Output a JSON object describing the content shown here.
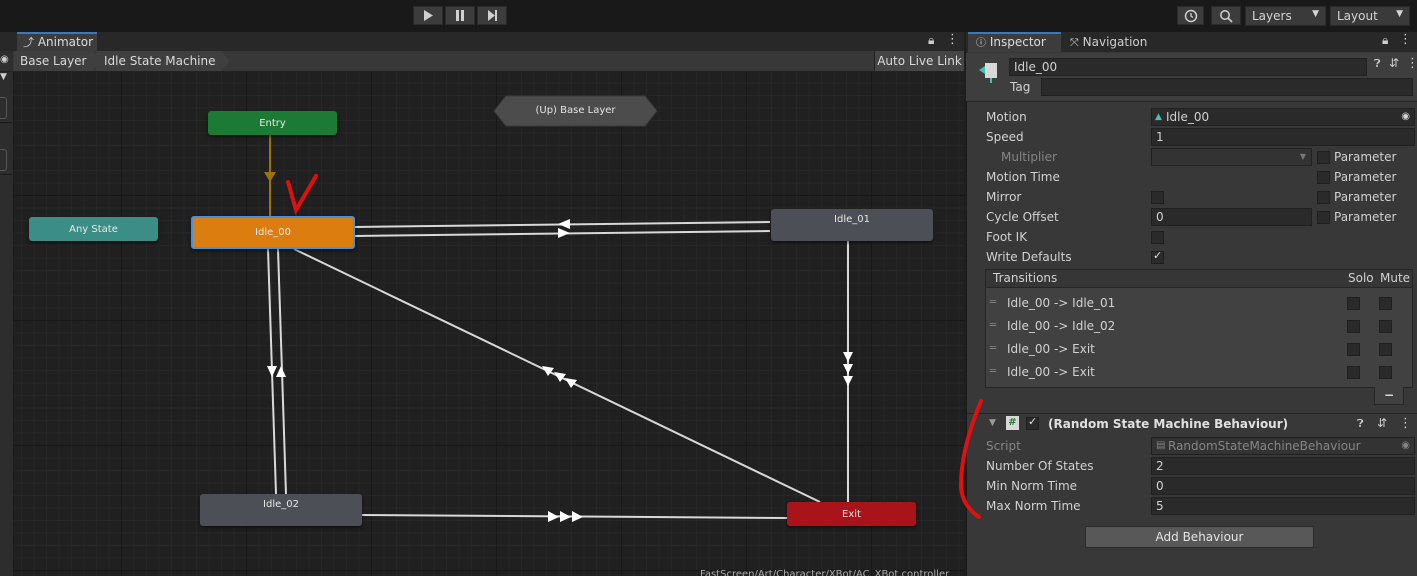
{
  "toolbar": {
    "layers_label": "Layers",
    "layout_label": "Layout"
  },
  "animator": {
    "tab_label": "Animator",
    "breadcrumbs": [
      "Base Layer",
      "Idle State Machine"
    ],
    "auto_live_link": "Auto Live Link",
    "footer_path": "FastScreen/Art/Character/XBot/AC_XBot.controller",
    "nodes": {
      "entry": "Entry",
      "up_base": "(Up) Base Layer",
      "any_state": "Any State",
      "idle_00": "Idle_00",
      "idle_01": "Idle_01",
      "idle_02": "Idle_02",
      "exit": "Exit"
    },
    "annotation_mark": "V"
  },
  "inspector": {
    "tabs": [
      "Inspector",
      "Navigation"
    ],
    "object_name": "Idle_00",
    "tag_label": "Tag",
    "properties": [
      {
        "label": "Motion",
        "value": "Idle_00"
      },
      {
        "label": "Speed",
        "value": "1"
      },
      {
        "label": "Multiplier",
        "value": ""
      },
      {
        "label": "Motion Time",
        "value": ""
      },
      {
        "label": "Mirror",
        "value": ""
      },
      {
        "label": "Cycle Offset",
        "value": "0"
      },
      {
        "label": "Foot IK",
        "value": ""
      },
      {
        "label": "Write Defaults",
        "value": ""
      }
    ],
    "parameter_label": "Parameter",
    "transitions": {
      "header": "Transitions",
      "solo": "Solo",
      "mute": "Mute",
      "items": [
        "Idle_00 -> Idle_01",
        "Idle_00 -> Idle_02",
        "Idle_00 -> Exit",
        "Idle_00 -> Exit"
      ],
      "remove_label": "−"
    },
    "behaviour": {
      "title": "(Random State Machine Behaviour)",
      "script_label": "Script",
      "script_value": "RandomStateMachineBehaviour",
      "fields": [
        {
          "label": "Number Of States",
          "value": "2"
        },
        {
          "label": "Min Norm Time",
          "value": "0"
        },
        {
          "label": "Max Norm Time",
          "value": "5"
        }
      ]
    },
    "add_behaviour": "Add Behaviour"
  }
}
